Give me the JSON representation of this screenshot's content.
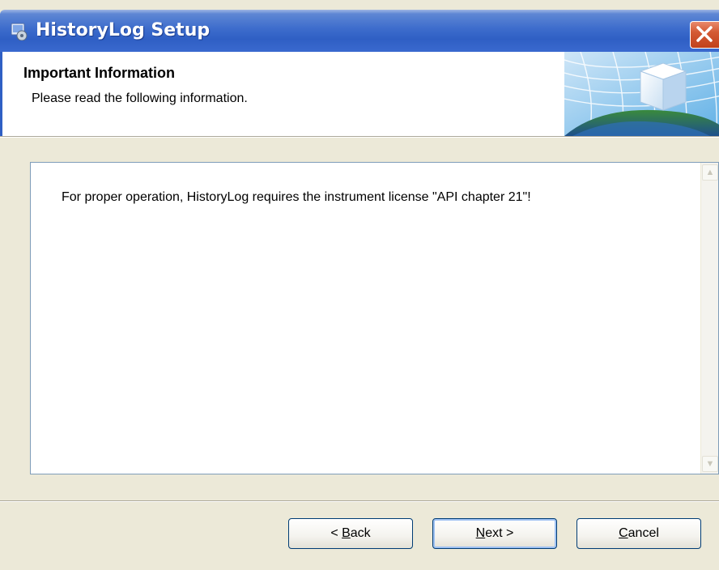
{
  "window": {
    "title": "HistoryLog Setup"
  },
  "header": {
    "title": "Important Information",
    "subtitle": "Please read the following information."
  },
  "info": {
    "text": "For proper operation, HistoryLog requires the instrument license \"API chapter 21\"!"
  },
  "buttons": {
    "back": {
      "prefix": "< ",
      "accel": "B",
      "rest": "ack"
    },
    "next": {
      "accel": "N",
      "rest": "ext >"
    },
    "cancel": {
      "accel": "C",
      "rest": "ancel"
    }
  },
  "colors": {
    "titlebar": "#2f5fc4",
    "dialog_bg": "#ece9d8",
    "close_button": "#c1411c",
    "button_border": "#003c74"
  },
  "icons": {
    "titlebar": "setup-installer-icon",
    "close": "close-icon",
    "header_graphic": "setup-cube-globe-graphic",
    "scroll_up": "scroll-up-arrow-icon",
    "scroll_down": "scroll-down-arrow-icon"
  }
}
